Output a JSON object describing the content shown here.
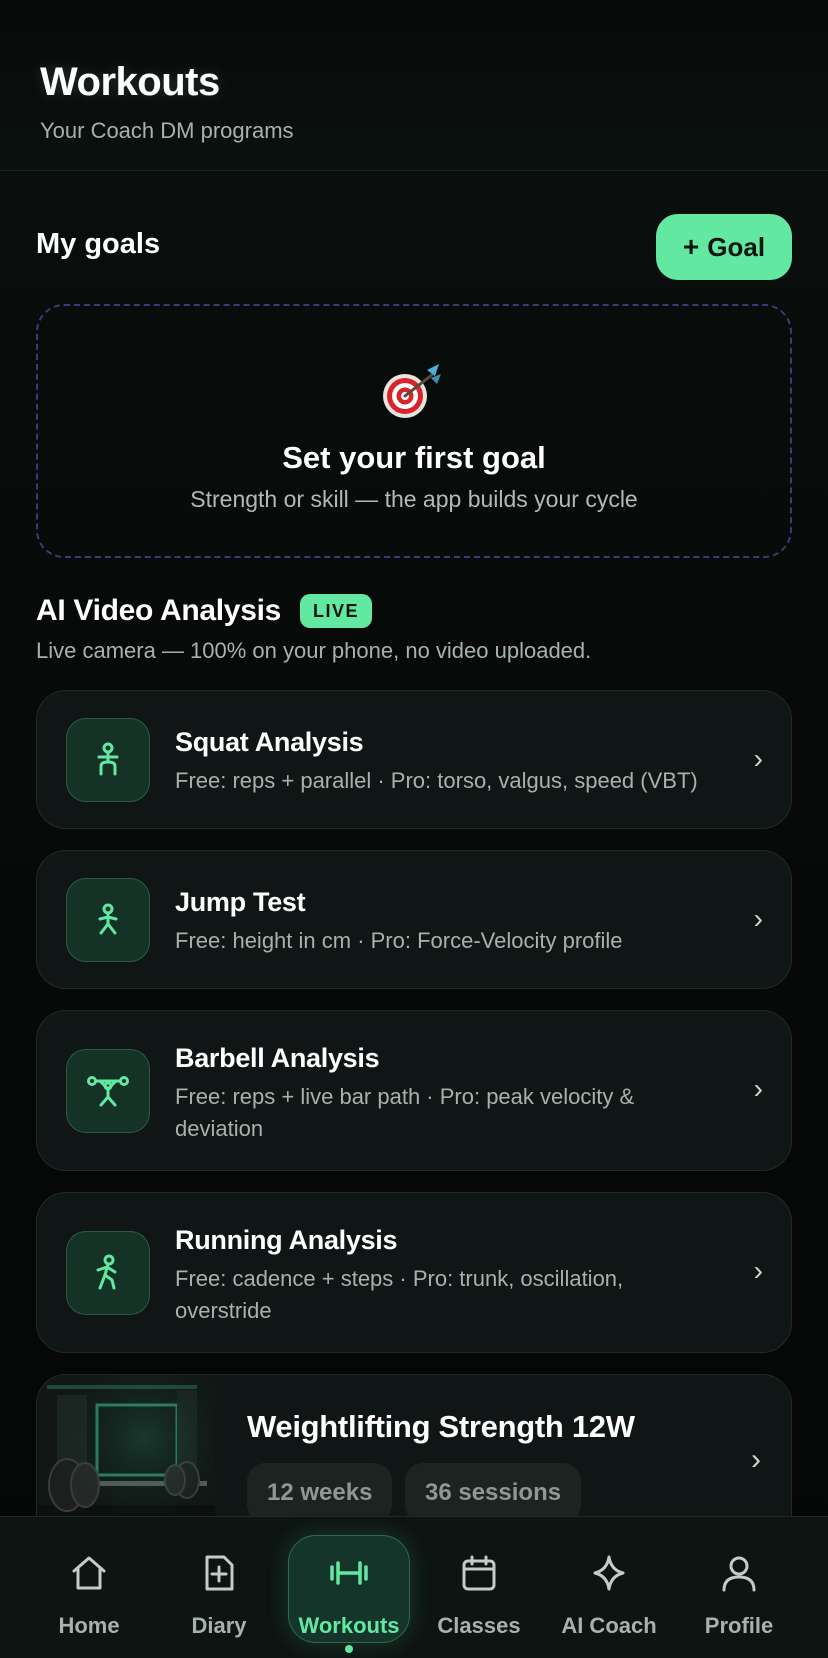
{
  "header": {
    "title": "Workouts",
    "subtitle": "Your Coach DM programs"
  },
  "goals": {
    "title": "My goals",
    "add_button": "Goal",
    "empty_icon": "target-dart-icon",
    "empty_title": "Set your first goal",
    "empty_subtitle": "Strength or skill — the app builds your cycle"
  },
  "ai_video": {
    "title": "AI Video Analysis",
    "badge": "LIVE",
    "subtitle": "Live camera — 100% on your phone, no video uploaded.",
    "cards": [
      {
        "title": "Squat Analysis",
        "desc": "Free: reps + parallel · Pro: torso, valgus, speed (VBT)",
        "icon": "squat-figure-icon"
      },
      {
        "title": "Jump Test",
        "desc": "Free: height in cm · Pro: Force-Velocity profile",
        "icon": "jump-figure-icon"
      },
      {
        "title": "Barbell Analysis",
        "desc": "Free: reps + live bar path · Pro: peak velocity & deviation",
        "icon": "barbell-figure-icon"
      },
      {
        "title": "Running Analysis",
        "desc": "Free: cadence + steps · Pro: trunk, oscillation, overstride",
        "icon": "running-figure-icon"
      }
    ]
  },
  "program": {
    "title": "Weightlifting Strength 12W",
    "weeks": "12 weeks",
    "sessions": "36 sessions"
  },
  "nav": {
    "items": [
      {
        "label": "Home",
        "icon": "home-icon"
      },
      {
        "label": "Diary",
        "icon": "diary-icon"
      },
      {
        "label": "Workouts",
        "icon": "dumbbell-icon"
      },
      {
        "label": "Classes",
        "icon": "calendar-icon"
      },
      {
        "label": "AI Coach",
        "icon": "sparkle-icon"
      },
      {
        "label": "Profile",
        "icon": "profile-icon"
      }
    ],
    "active": "Workouts"
  },
  "colors": {
    "accent": "#63e8a2",
    "background": "#050707",
    "card": "#101615",
    "dashed_border": "#3d3a78"
  }
}
